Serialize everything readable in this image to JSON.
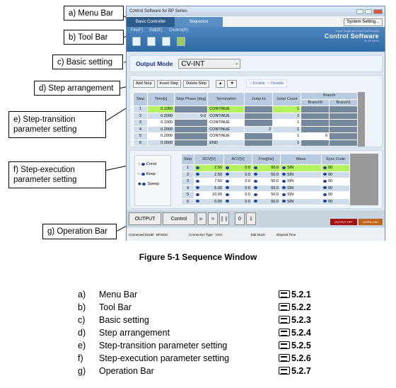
{
  "callouts": [
    "a) Menu Bar",
    "b) Tool Bar",
    "c) Basic setting",
    "d) Step arrangement",
    "e) Step-transition parameter setting",
    "f) Step-execution parameter setting",
    "g) Operation Bar"
  ],
  "window": {
    "title": "Control Software for BP Series",
    "tabs": [
      "Basic Controller",
      "Sequence"
    ],
    "system_setting": "System Setting...",
    "menu": [
      "File(F)",
      "Edit(E)",
      "Control(R)"
    ],
    "brand_small": "Power Supply and Power Test Products",
    "brand": "Control Software",
    "brand_sub": "for BP Series"
  },
  "basic": {
    "label": "Output Mode",
    "value": "CV-INT"
  },
  "arrange": {
    "buttons": [
      "Add Step",
      "Insert Step",
      "Delete Step"
    ],
    "up": "▲",
    "down": "▼",
    "radios": [
      "Enable",
      "Disable"
    ]
  },
  "transition": {
    "headers": [
      "Step",
      "Time[s]",
      "Stop Phase [deg]",
      "Termination",
      "Jump-to",
      "Jump Count",
      "Branch",
      "Branch0",
      "Branch1"
    ],
    "rows": [
      [
        "1",
        "0.1000",
        "",
        "CONTINUE",
        "",
        "1",
        "",
        ""
      ],
      [
        "2",
        "0.2000",
        "0.0",
        "CONTINUE",
        "",
        "1",
        "",
        ""
      ],
      [
        "3",
        "0.1000",
        "",
        "CONTINUE",
        "",
        "1",
        "",
        ""
      ],
      [
        "4",
        "0.2000",
        "",
        "CONTINUE",
        "2",
        "1",
        "",
        ""
      ],
      [
        "5",
        "0.2000",
        "",
        "CONTINUE",
        "",
        "1",
        "6",
        ""
      ],
      [
        "6",
        "0.3000",
        "",
        "END",
        "",
        "1",
        "",
        ""
      ]
    ]
  },
  "execution": {
    "modes": [
      "Const",
      "Keep",
      "Sweep"
    ],
    "headers": [
      "Step",
      "DCV[V]",
      "ACV[V]",
      "Freq[Hz]",
      "Wave",
      "Sync Code"
    ],
    "rows": [
      [
        "1",
        "2.50",
        "0.0",
        "50.0",
        "SIN",
        "00"
      ],
      [
        "2",
        "2.50",
        "0.0",
        "50.0",
        "SIN",
        "00"
      ],
      [
        "3",
        "7.50",
        "0.0",
        "50.0",
        "SIN",
        "00"
      ],
      [
        "4",
        "5.00",
        "0.0",
        "50.0",
        "SIN",
        "00"
      ],
      [
        "5",
        "10.00",
        "0.0",
        "50.0",
        "SIN",
        "00"
      ],
      [
        "6",
        "0.00",
        "0.0",
        "50.0",
        "SIN",
        "00"
      ]
    ]
  },
  "operation": {
    "output": "OUTPUT",
    "control": "Control",
    "n0": "0",
    "n1": "1",
    "output_off": "OUTPUT OFF",
    "overload": "OVERLOAD"
  },
  "status": [
    "Connected Model:",
    "BP4610",
    "Connection Type:",
    "VISA",
    "Edit Mode",
    "Elapsed Time"
  ],
  "caption": "Figure 5-1 Sequence Window",
  "list": [
    {
      "k": "a)",
      "t": "Menu Bar",
      "r": "5.2.1"
    },
    {
      "k": "b)",
      "t": "Tool Bar",
      "r": "5.2.2"
    },
    {
      "k": "c)",
      "t": "Basic setting",
      "r": "5.2.3"
    },
    {
      "k": "d)",
      "t": "Step arrangement",
      "r": "5.2.4"
    },
    {
      "k": "e)",
      "t": "Step-transition parameter setting",
      "r": "5.2.5"
    },
    {
      "k": "f)",
      "t": "Step-execution parameter setting",
      "r": "5.2.6"
    },
    {
      "k": "g)",
      "t": "Operation Bar",
      "r": "5.2.7"
    }
  ]
}
